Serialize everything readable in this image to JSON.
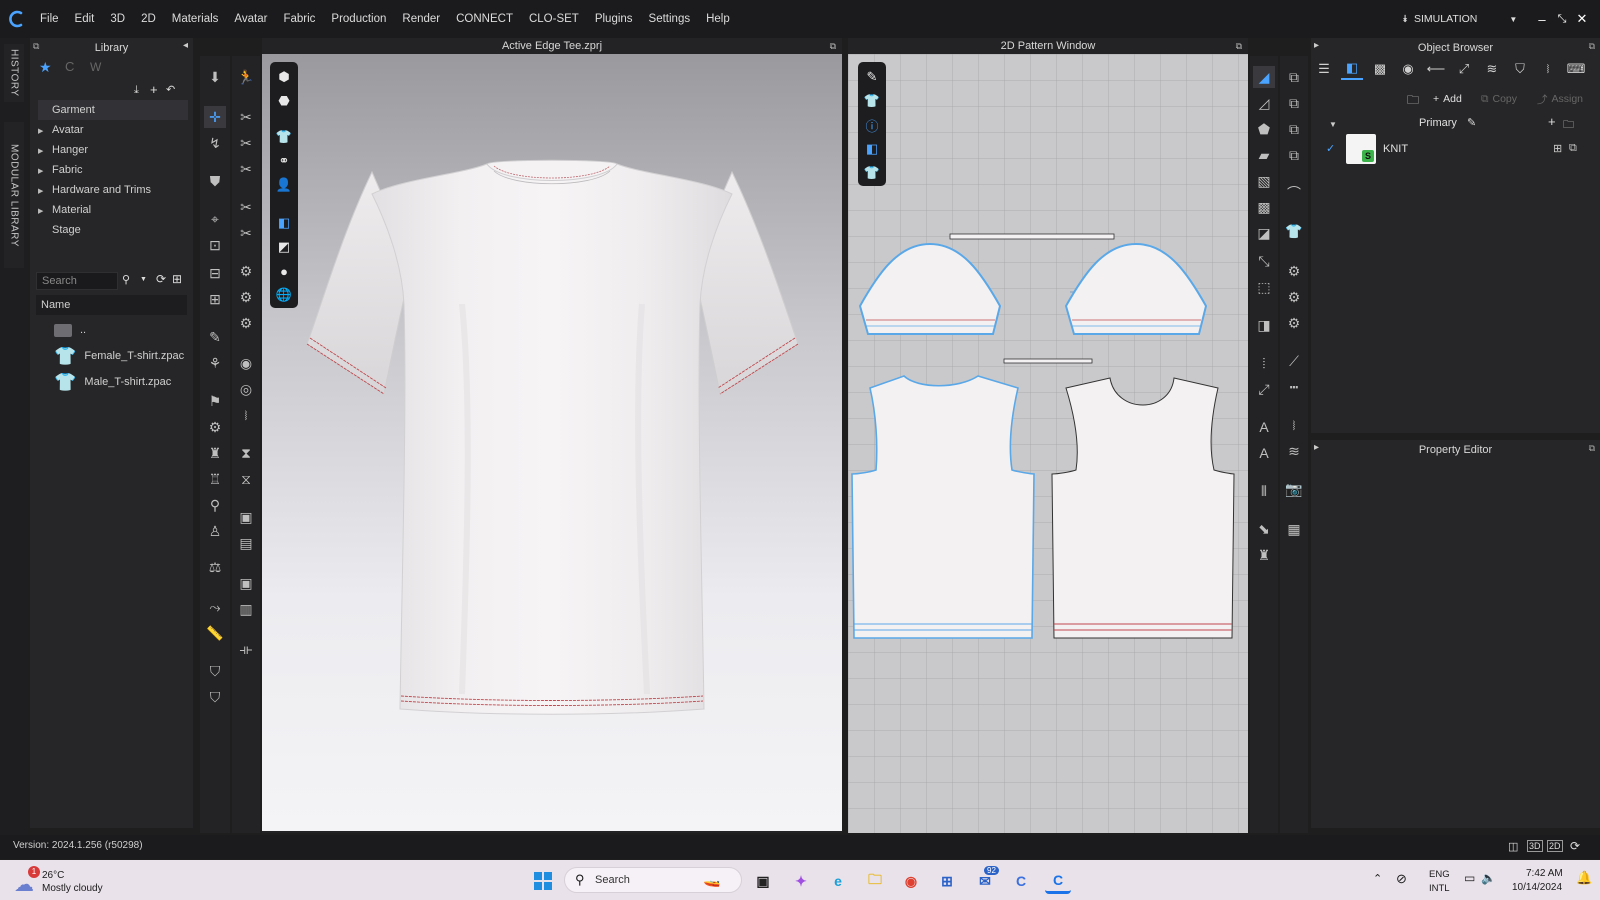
{
  "app": {
    "logo": "C",
    "menu": [
      "File",
      "Edit",
      "3D",
      "2D",
      "Materials",
      "Avatar",
      "Fabric",
      "Production",
      "Render",
      "CONNECT",
      "CLO-SET",
      "Plugins",
      "Settings",
      "Help"
    ],
    "mode": "SIMULATION"
  },
  "side_tabs": [
    "HISTORY",
    "MODULAR LIBRARY"
  ],
  "library": {
    "title": "Library",
    "tree": [
      {
        "label": "Garment",
        "selected": true,
        "expandable": false
      },
      {
        "label": "Avatar",
        "expandable": true
      },
      {
        "label": "Hanger",
        "expandable": true
      },
      {
        "label": "Fabric",
        "expandable": true
      },
      {
        "label": "Hardware and Trims",
        "expandable": true
      },
      {
        "label": "Material",
        "expandable": true
      },
      {
        "label": "Stage",
        "expandable": false
      }
    ],
    "search_placeholder": "Search",
    "column_header": "Name",
    "files": [
      "..",
      "Female_T-shirt.zpac",
      "Male_T-shirt.zpac"
    ]
  },
  "window3d": {
    "title": "Active Edge Tee.zprj"
  },
  "window2d": {
    "title": "2D Pattern Window"
  },
  "object_browser": {
    "title": "Object Browser",
    "buttons": {
      "add": "Add",
      "copy": "Copy",
      "assign": "Assign"
    },
    "colorway": "Primary",
    "items": [
      {
        "name": "KNIT",
        "checked": true
      }
    ]
  },
  "property_editor": {
    "title": "Property Editor"
  },
  "status": {
    "version": "Version: 2024.1.256 (r50298)",
    "view_modes": [
      "2D/3D",
      "3D",
      "2D"
    ]
  },
  "taskbar": {
    "weather_temp": "26°C",
    "weather_desc": "Mostly cloudy",
    "weather_badge": "1",
    "search_placeholder": "Search",
    "mail_badge": "92",
    "lang_1": "ENG",
    "lang_2": "INTL",
    "time": "7:42 AM",
    "date": "10/14/2024"
  },
  "colors": {
    "accent": "#4aa3ff",
    "pattern_selected": "#5aa8e8",
    "stitch_red": "#c0484e",
    "panel_bg": "#262628"
  }
}
